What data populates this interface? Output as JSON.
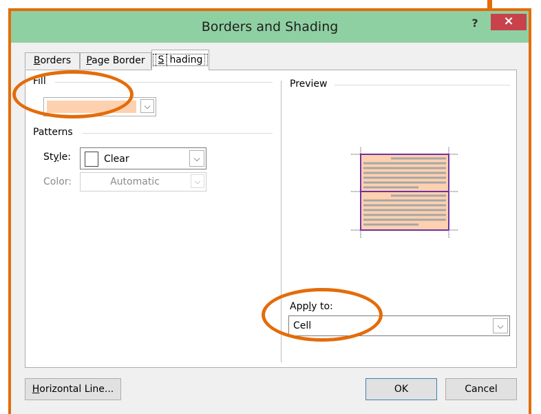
{
  "dialog": {
    "title": "Borders and Shading",
    "help_label": "?",
    "close_label": "×"
  },
  "tabs": [
    {
      "label": "Borders",
      "accel": "B",
      "rest": "orders"
    },
    {
      "label": "Page Border",
      "accel_prefix": "",
      "accel": "P",
      "rest": "age Border"
    },
    {
      "label": "Shading",
      "accel": "S",
      "rest": "hading",
      "active": true
    }
  ],
  "fill": {
    "group_label": "Fill",
    "swatch_color": "#fdd1b0"
  },
  "patterns": {
    "group_label": "Patterns",
    "style_label_pre": "St",
    "style_label_accel": "y",
    "style_label_post": "le:",
    "style_value": "Clear",
    "color_label": "Color:",
    "color_value": "Automatic"
  },
  "preview": {
    "group_label": "Preview",
    "shade_color": "#fdd1b0",
    "border_color": "#7030a0",
    "line_color": "#a6a6a6"
  },
  "apply_to": {
    "label_pre": "App",
    "label_accel": "l",
    "label_post": "y to:",
    "value": "Cell"
  },
  "buttons": {
    "hline_accel": "H",
    "hline_rest": "orizontal Line...",
    "ok": "OK",
    "cancel": "Cancel"
  },
  "colors": {
    "annotation": "#e46c0a",
    "titlebar": "#8fd0a2",
    "close": "#c8424b"
  }
}
